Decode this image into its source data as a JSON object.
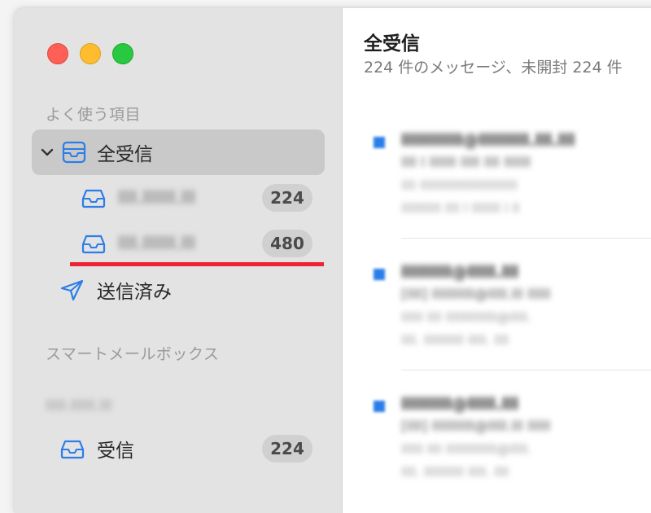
{
  "sidebar": {
    "favorites_header": "よく使う項目",
    "smart_header": "スマートメールボックス",
    "account_header": "lllll.llllll.lll",
    "items": [
      {
        "label": "全受信",
        "icon": "inbox-icon",
        "expanded": true
      },
      {
        "label": "llll.lllllll.lll",
        "badge": "224",
        "icon": "inbox-icon"
      },
      {
        "label": "llll.lllllll.lll",
        "badge": "480",
        "icon": "inbox-icon"
      },
      {
        "label": "送信済み",
        "icon": "paper-plane-icon"
      }
    ],
    "account_items": [
      {
        "label": "受信",
        "badge": "224",
        "icon": "inbox-icon"
      }
    ]
  },
  "main": {
    "title": "全受信",
    "subtitle": "224 件のメッセージ、未開封 224 件",
    "messages": [
      {
        "sender": "lllllllllll@lllllllll.lll.lll",
        "subject": "llll l lllllll lllll llll lllllll",
        "preview1": "llll lllllllllllllllllllllllllll",
        "preview2": "lllllllllll llll l llllllll l ll"
      },
      {
        "sender": "lllllllll@lllll.lll",
        "subject": "[llll] lllllllllll@lllll.lll llllll",
        "preview1": "llllll llll llllllllllllll@lllll.",
        "preview2": "llll. lllllllllll lllll. llll"
      },
      {
        "sender": "lllllllll@lllll.lll",
        "subject": "[llll] lllllllllll@lllll.lll llllll",
        "preview1": "llllll llll llllllllllllll@lllll.",
        "preview2": "llll. lllllllllll lllll. llll"
      }
    ]
  },
  "colors": {
    "accent": "#2b7de9",
    "highlight": "#ee2233",
    "sidebar_bg": "#e3e3e3",
    "selected_bg": "#c9c9c9"
  }
}
